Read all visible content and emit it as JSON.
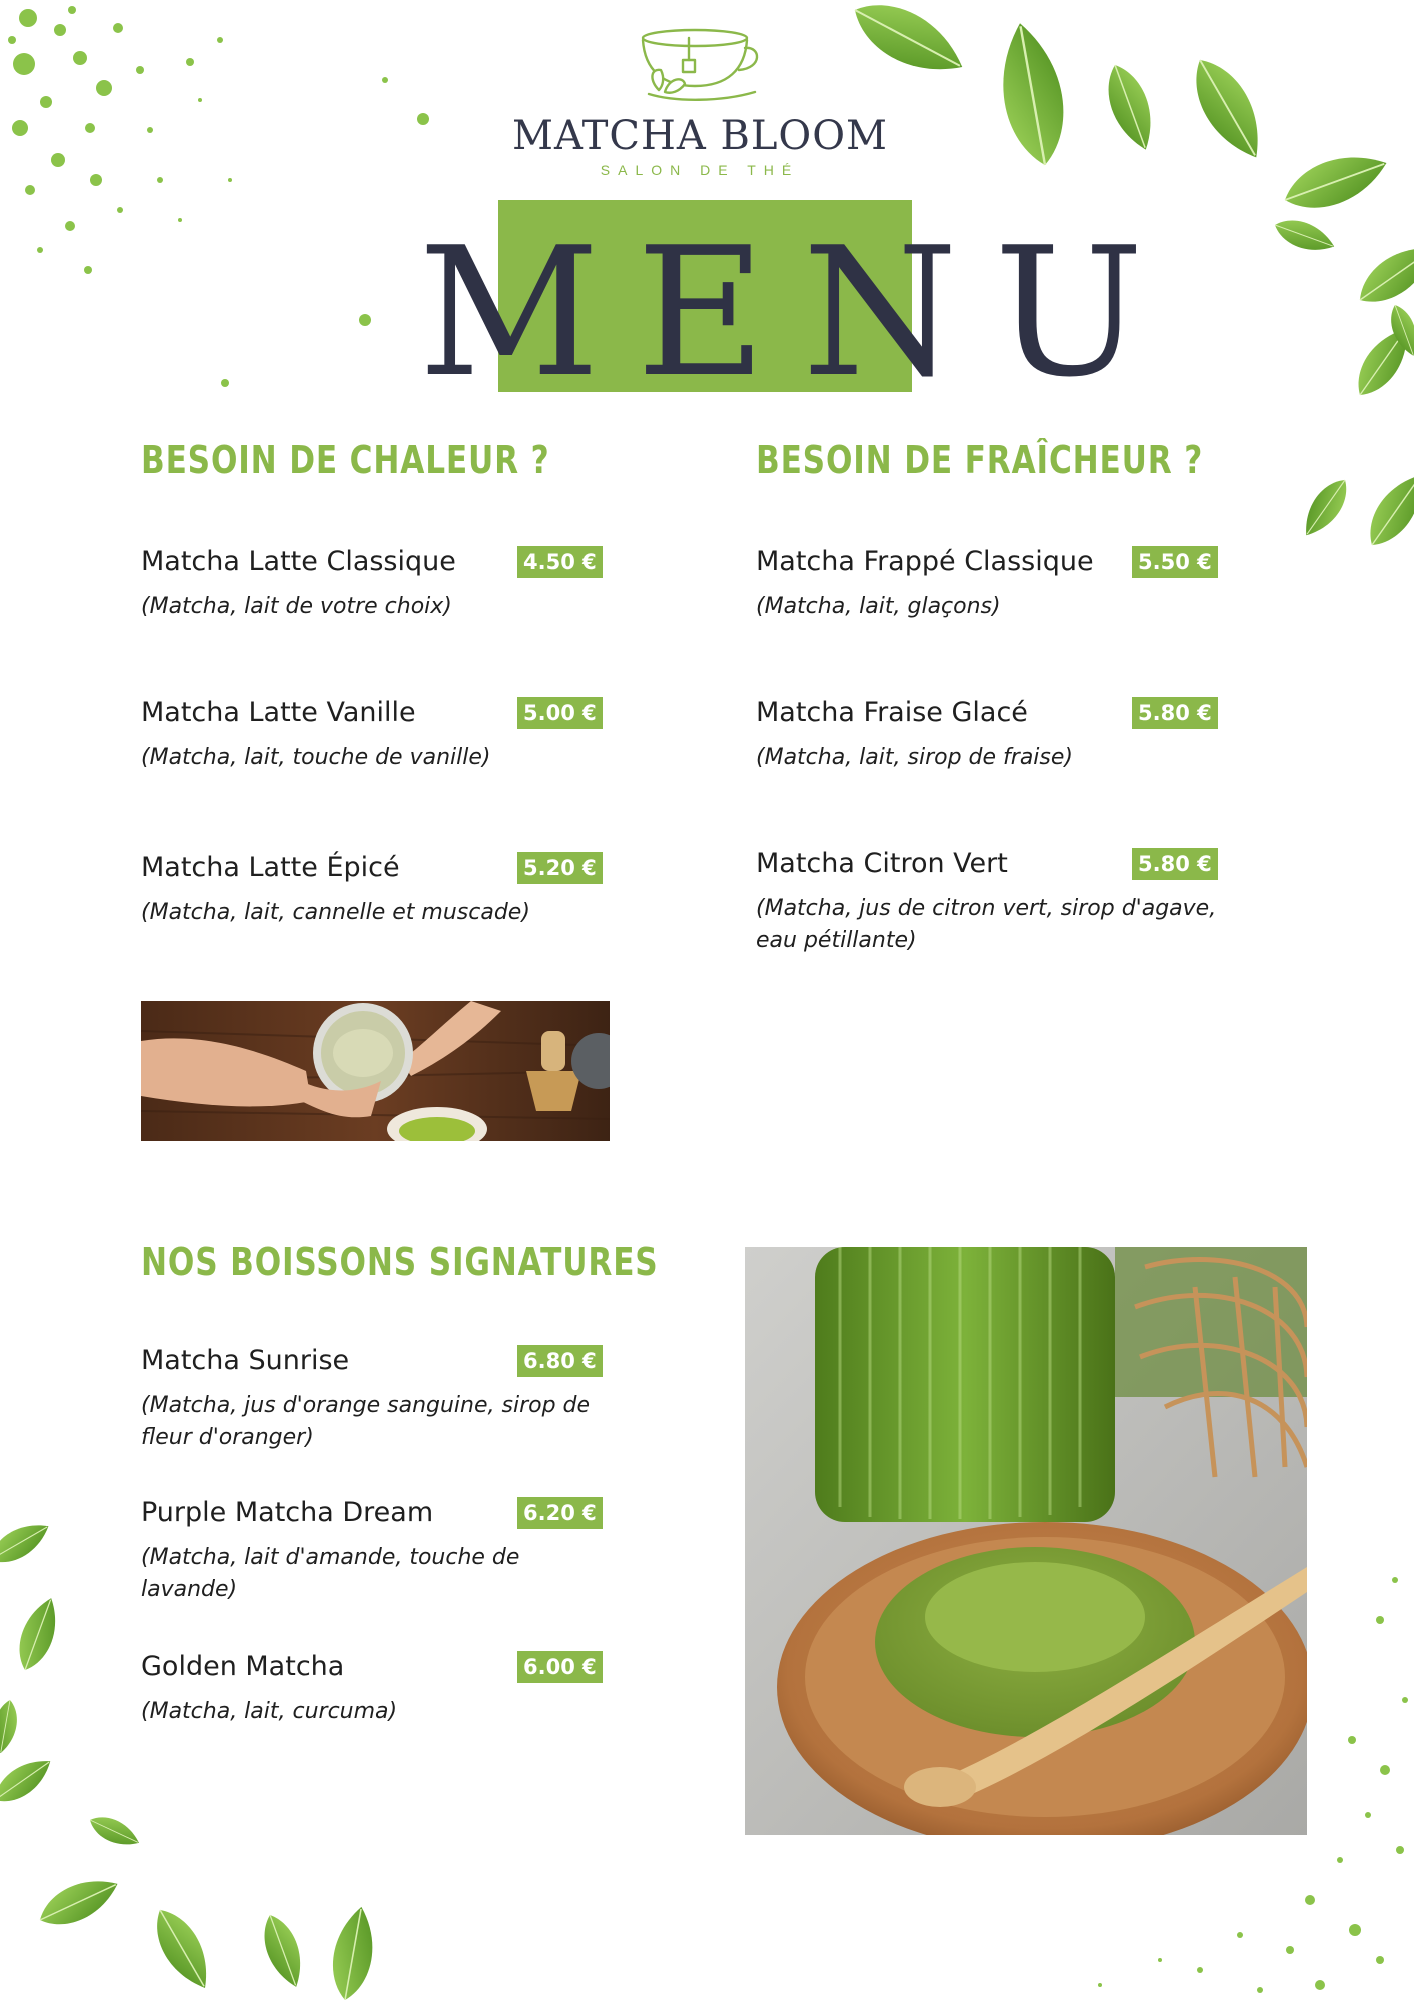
{
  "brand": {
    "name": "MATCHA BLOOM",
    "tagline": "SALON DE THÉ"
  },
  "menu_title": "MENU",
  "sections": [
    {
      "title": "BESOIN DE CHALEUR ?",
      "items": [
        {
          "name": "Matcha Latte Classique",
          "price": "4.50 €",
          "desc": " (Matcha, lait de votre choix)"
        },
        {
          "name": "Matcha Latte Vanille",
          "price": "5.00 €",
          "desc": "(Matcha, lait, touche de vanille)"
        },
        {
          "name": "Matcha Latte Épicé",
          "price": "5.20 €",
          "desc": "(Matcha, lait, cannelle et muscade)"
        }
      ]
    },
    {
      "title": "BESOIN DE FRAÎCHEUR ?",
      "items": [
        {
          "name": "Matcha Frappé Classique",
          "price": "5.50 €",
          "desc": "(Matcha, lait, glaçons)"
        },
        {
          "name": "Matcha Fraise Glacé",
          "price": "5.80 €",
          "desc": "(Matcha, lait, sirop de fraise)"
        },
        {
          "name": "Matcha Citron Vert",
          "price": "5.80 €",
          "desc": "(Matcha, jus de citron vert, sirop d'agave, eau pétillante)"
        }
      ]
    },
    {
      "title": "NOS BOISSONS SIGNATURES",
      "items": [
        {
          "name": "Matcha Sunrise",
          "price": "6.80 €",
          "desc": "(Matcha, jus d'orange sanguine, sirop de fleur d'oranger)"
        },
        {
          "name": "Purple Matcha Dream",
          "price": "6.20 €",
          "desc": "(Matcha, lait d'amande, touche de lavande)"
        },
        {
          "name": "Golden Matcha",
          "price": "6.00 €",
          "desc": "(Matcha, lait, curcuma)"
        }
      ]
    }
  ],
  "colors": {
    "accent_green": "#8bb84a",
    "title_navy": "#2f3245",
    "text": "#1f1f1f",
    "background": "#ffffff"
  },
  "icons": [
    "teacup-logo-icon",
    "tea-leaf-icon"
  ],
  "images": [
    "matcha-latte-hands-photo",
    "matcha-powder-plate-photo"
  ]
}
